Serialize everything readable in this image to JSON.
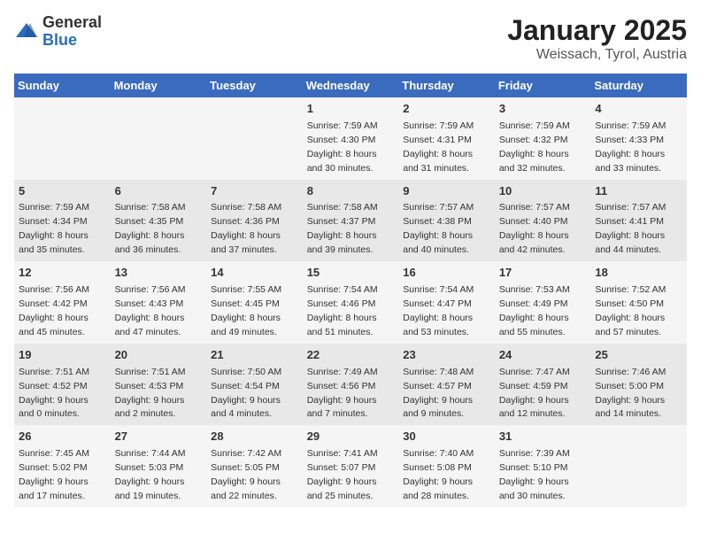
{
  "logo": {
    "general": "General",
    "blue": "Blue"
  },
  "title": "January 2025",
  "subtitle": "Weissach, Tyrol, Austria",
  "days_of_week": [
    "Sunday",
    "Monday",
    "Tuesday",
    "Wednesday",
    "Thursday",
    "Friday",
    "Saturday"
  ],
  "weeks": [
    [
      {
        "day": "",
        "info": ""
      },
      {
        "day": "",
        "info": ""
      },
      {
        "day": "",
        "info": ""
      },
      {
        "day": "1",
        "info": "Sunrise: 7:59 AM\nSunset: 4:30 PM\nDaylight: 8 hours\nand 30 minutes."
      },
      {
        "day": "2",
        "info": "Sunrise: 7:59 AM\nSunset: 4:31 PM\nDaylight: 8 hours\nand 31 minutes."
      },
      {
        "day": "3",
        "info": "Sunrise: 7:59 AM\nSunset: 4:32 PM\nDaylight: 8 hours\nand 32 minutes."
      },
      {
        "day": "4",
        "info": "Sunrise: 7:59 AM\nSunset: 4:33 PM\nDaylight: 8 hours\nand 33 minutes."
      }
    ],
    [
      {
        "day": "5",
        "info": "Sunrise: 7:59 AM\nSunset: 4:34 PM\nDaylight: 8 hours\nand 35 minutes."
      },
      {
        "day": "6",
        "info": "Sunrise: 7:58 AM\nSunset: 4:35 PM\nDaylight: 8 hours\nand 36 minutes."
      },
      {
        "day": "7",
        "info": "Sunrise: 7:58 AM\nSunset: 4:36 PM\nDaylight: 8 hours\nand 37 minutes."
      },
      {
        "day": "8",
        "info": "Sunrise: 7:58 AM\nSunset: 4:37 PM\nDaylight: 8 hours\nand 39 minutes."
      },
      {
        "day": "9",
        "info": "Sunrise: 7:57 AM\nSunset: 4:38 PM\nDaylight: 8 hours\nand 40 minutes."
      },
      {
        "day": "10",
        "info": "Sunrise: 7:57 AM\nSunset: 4:40 PM\nDaylight: 8 hours\nand 42 minutes."
      },
      {
        "day": "11",
        "info": "Sunrise: 7:57 AM\nSunset: 4:41 PM\nDaylight: 8 hours\nand 44 minutes."
      }
    ],
    [
      {
        "day": "12",
        "info": "Sunrise: 7:56 AM\nSunset: 4:42 PM\nDaylight: 8 hours\nand 45 minutes."
      },
      {
        "day": "13",
        "info": "Sunrise: 7:56 AM\nSunset: 4:43 PM\nDaylight: 8 hours\nand 47 minutes."
      },
      {
        "day": "14",
        "info": "Sunrise: 7:55 AM\nSunset: 4:45 PM\nDaylight: 8 hours\nand 49 minutes."
      },
      {
        "day": "15",
        "info": "Sunrise: 7:54 AM\nSunset: 4:46 PM\nDaylight: 8 hours\nand 51 minutes."
      },
      {
        "day": "16",
        "info": "Sunrise: 7:54 AM\nSunset: 4:47 PM\nDaylight: 8 hours\nand 53 minutes."
      },
      {
        "day": "17",
        "info": "Sunrise: 7:53 AM\nSunset: 4:49 PM\nDaylight: 8 hours\nand 55 minutes."
      },
      {
        "day": "18",
        "info": "Sunrise: 7:52 AM\nSunset: 4:50 PM\nDaylight: 8 hours\nand 57 minutes."
      }
    ],
    [
      {
        "day": "19",
        "info": "Sunrise: 7:51 AM\nSunset: 4:52 PM\nDaylight: 9 hours\nand 0 minutes."
      },
      {
        "day": "20",
        "info": "Sunrise: 7:51 AM\nSunset: 4:53 PM\nDaylight: 9 hours\nand 2 minutes."
      },
      {
        "day": "21",
        "info": "Sunrise: 7:50 AM\nSunset: 4:54 PM\nDaylight: 9 hours\nand 4 minutes."
      },
      {
        "day": "22",
        "info": "Sunrise: 7:49 AM\nSunset: 4:56 PM\nDaylight: 9 hours\nand 7 minutes."
      },
      {
        "day": "23",
        "info": "Sunrise: 7:48 AM\nSunset: 4:57 PM\nDaylight: 9 hours\nand 9 minutes."
      },
      {
        "day": "24",
        "info": "Sunrise: 7:47 AM\nSunset: 4:59 PM\nDaylight: 9 hours\nand 12 minutes."
      },
      {
        "day": "25",
        "info": "Sunrise: 7:46 AM\nSunset: 5:00 PM\nDaylight: 9 hours\nand 14 minutes."
      }
    ],
    [
      {
        "day": "26",
        "info": "Sunrise: 7:45 AM\nSunset: 5:02 PM\nDaylight: 9 hours\nand 17 minutes."
      },
      {
        "day": "27",
        "info": "Sunrise: 7:44 AM\nSunset: 5:03 PM\nDaylight: 9 hours\nand 19 minutes."
      },
      {
        "day": "28",
        "info": "Sunrise: 7:42 AM\nSunset: 5:05 PM\nDaylight: 9 hours\nand 22 minutes."
      },
      {
        "day": "29",
        "info": "Sunrise: 7:41 AM\nSunset: 5:07 PM\nDaylight: 9 hours\nand 25 minutes."
      },
      {
        "day": "30",
        "info": "Sunrise: 7:40 AM\nSunset: 5:08 PM\nDaylight: 9 hours\nand 28 minutes."
      },
      {
        "day": "31",
        "info": "Sunrise: 7:39 AM\nSunset: 5:10 PM\nDaylight: 9 hours\nand 30 minutes."
      },
      {
        "day": "",
        "info": ""
      }
    ]
  ]
}
